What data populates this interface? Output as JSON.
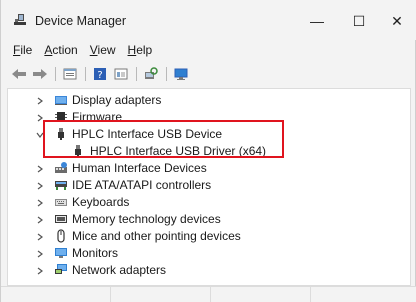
{
  "window": {
    "title": "Device Manager",
    "minimize_glyph": "—",
    "maximize_glyph": "☐",
    "close_glyph": "✕"
  },
  "menu": {
    "items": [
      {
        "label_first": "F",
        "label_rest": "ile"
      },
      {
        "label_first": "A",
        "label_rest": "ction"
      },
      {
        "label_first": "V",
        "label_rest": "iew"
      },
      {
        "label_first": "H",
        "label_rest": "elp"
      }
    ]
  },
  "toolbar": {
    "icons": [
      "back-arrow-icon",
      "forward-arrow-icon",
      "properties-icon",
      "help-icon",
      "show-hidden-icon",
      "scan-hardware-icon",
      "monitor-icon"
    ]
  },
  "tree": {
    "items": [
      {
        "label": "Display adapters",
        "icon": "display-adapter-icon",
        "expanded": false,
        "level": 0
      },
      {
        "label": "Firmware",
        "icon": "firmware-icon",
        "expanded": false,
        "level": 0
      },
      {
        "label": "HPLC Interface USB Device",
        "icon": "usb-device-icon",
        "expanded": true,
        "level": 0
      },
      {
        "label": "HPLC Interface USB Driver (x64)",
        "icon": "usb-device-icon",
        "expanded": false,
        "level": 1
      },
      {
        "label": "Human Interface Devices",
        "icon": "hid-icon",
        "expanded": false,
        "level": 0
      },
      {
        "label": "IDE ATA/ATAPI controllers",
        "icon": "ide-controller-icon",
        "expanded": false,
        "level": 0
      },
      {
        "label": "Keyboards",
        "icon": "keyboard-icon",
        "expanded": false,
        "level": 0
      },
      {
        "label": "Memory technology devices",
        "icon": "memory-icon",
        "expanded": false,
        "level": 0
      },
      {
        "label": "Mice and other pointing devices",
        "icon": "mouse-icon",
        "expanded": false,
        "level": 0
      },
      {
        "label": "Monitors",
        "icon": "monitor-icon",
        "expanded": false,
        "level": 0
      },
      {
        "label": "Network adapters",
        "icon": "network-adapter-icon",
        "expanded": false,
        "level": 0
      }
    ]
  },
  "colors": {
    "highlight_box": "#e0141e",
    "window_bg": "#f3f3f3",
    "tree_bg": "#ffffff"
  }
}
